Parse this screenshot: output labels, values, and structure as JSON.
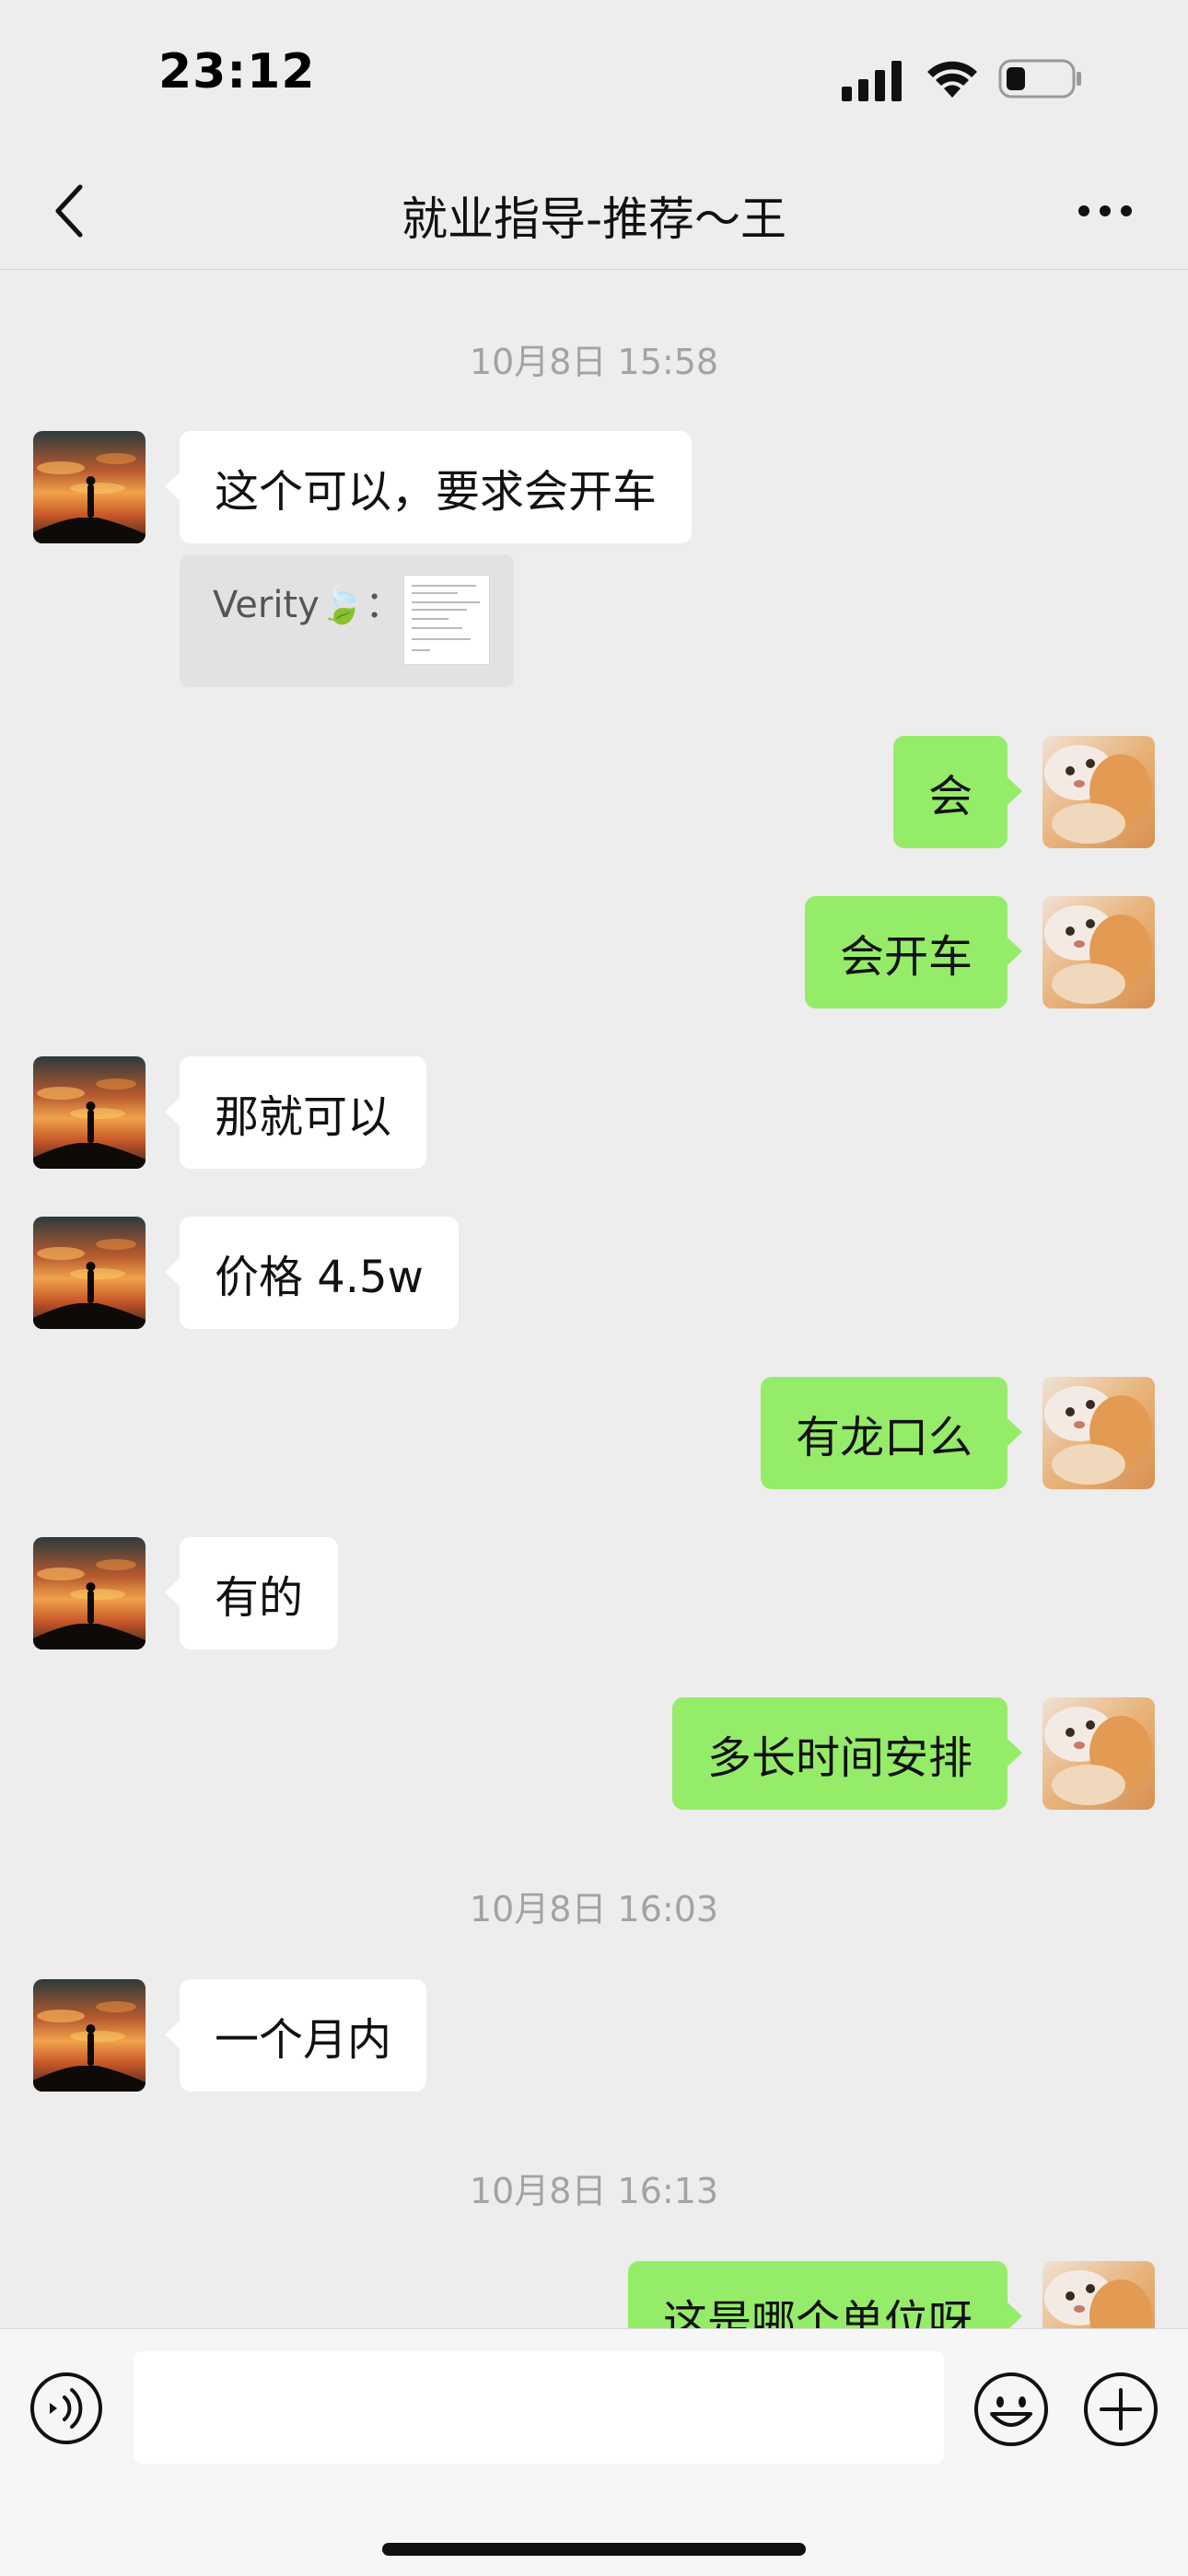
{
  "status_bar": {
    "time": "23:12",
    "icons": [
      "signal-icon",
      "wifi-icon",
      "battery-icon"
    ]
  },
  "nav": {
    "title": "就业指导-推荐～王",
    "back_icon": "chevron-left-icon",
    "more_icon": "more-dots-icon"
  },
  "colors": {
    "background": "#ededed",
    "outgoing_bubble": "#95ec69",
    "incoming_bubble": "#ffffff",
    "timestamp": "#a3a3a3"
  },
  "chat": {
    "timestamps": [
      "10月8日 15:58",
      "10月8日 16:03",
      "10月8日 16:13"
    ],
    "messages": [
      {
        "from": "contact",
        "text": "这个可以，要求会开车"
      },
      {
        "from": "me",
        "text": "会"
      },
      {
        "from": "me",
        "text": "会开车"
      },
      {
        "from": "contact",
        "text": "那就可以"
      },
      {
        "from": "contact",
        "text": "价格 4.5w"
      },
      {
        "from": "me",
        "text": "有龙口么"
      },
      {
        "from": "contact",
        "text": "有的"
      },
      {
        "from": "me",
        "text": "多长时间安排"
      },
      {
        "from": "contact",
        "text": "一个月内"
      },
      {
        "from": "me",
        "text": "这是哪个单位呀"
      }
    ],
    "quote": {
      "sender": "Verity🍃："
    }
  },
  "input_bar": {
    "value": "",
    "icons": [
      "voice-icon",
      "emoji-icon",
      "plus-icon"
    ]
  }
}
